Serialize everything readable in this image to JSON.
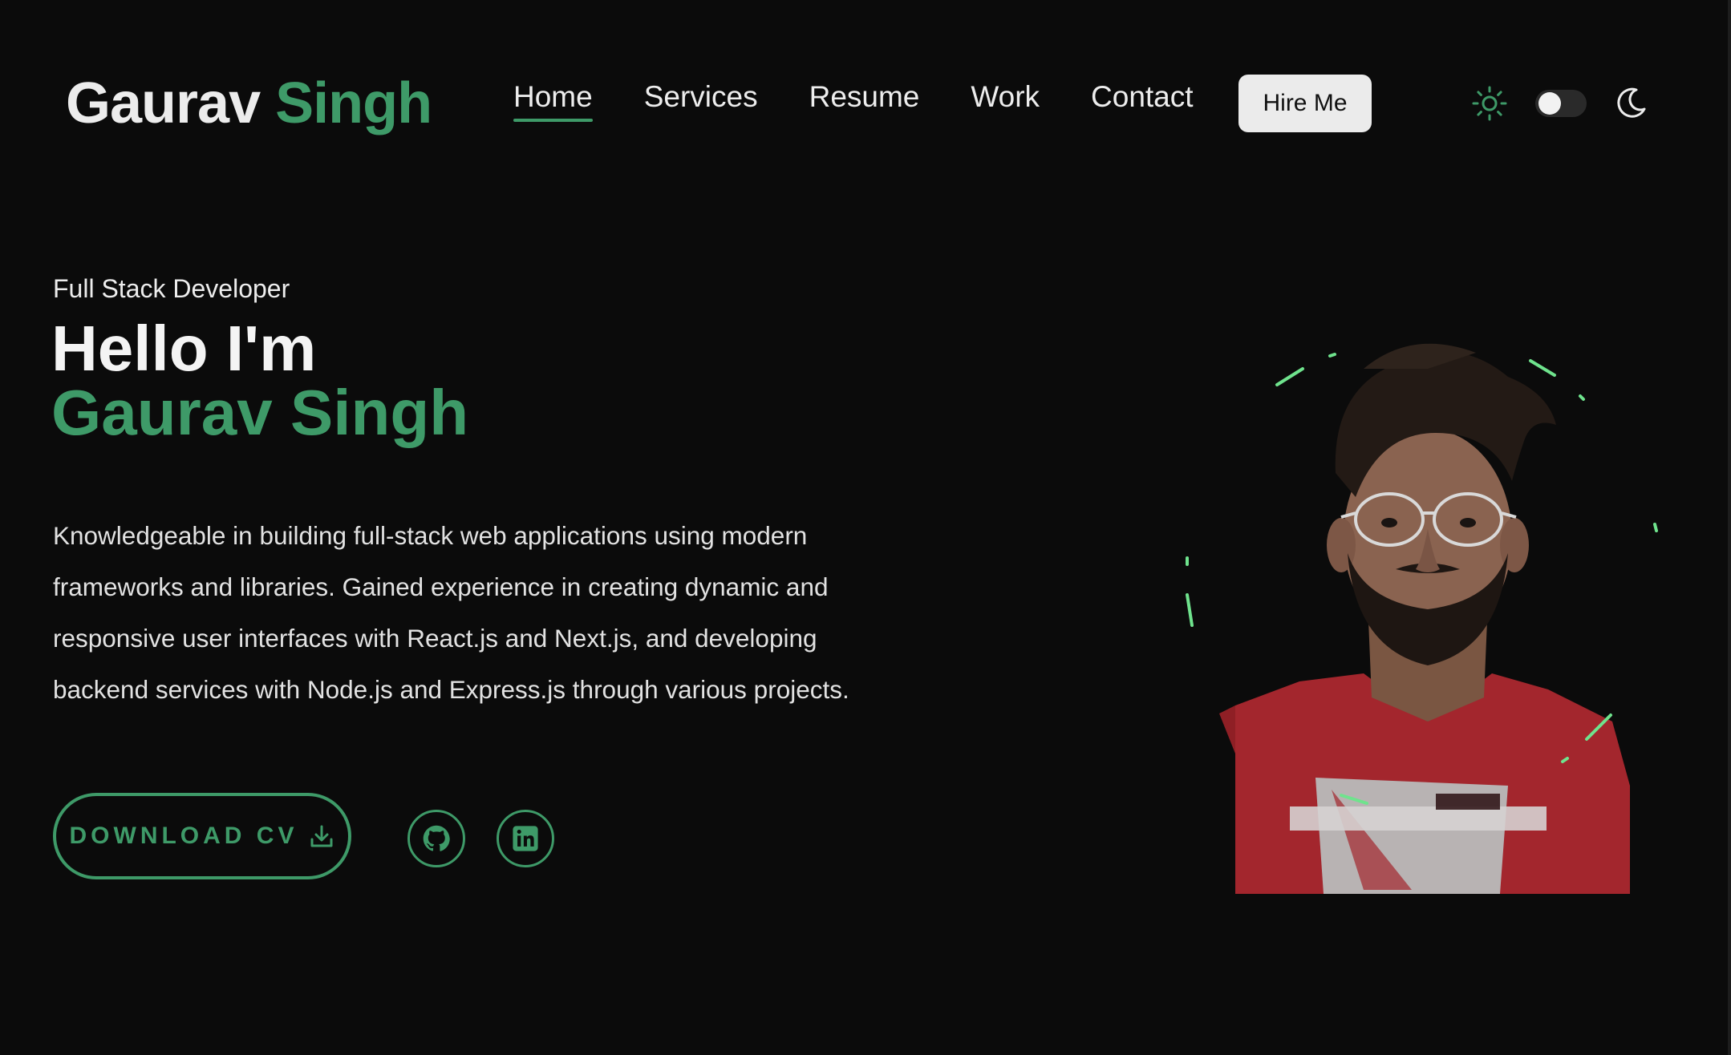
{
  "header": {
    "logo": {
      "first": "Gaurav",
      "last": "Singh"
    },
    "nav": [
      {
        "label": "Home",
        "active": true
      },
      {
        "label": "Services",
        "active": false
      },
      {
        "label": "Resume",
        "active": false
      },
      {
        "label": "Work",
        "active": false
      },
      {
        "label": "Contact",
        "active": false
      }
    ],
    "hire_label": "Hire Me",
    "theme": {
      "mode": "dark",
      "icons": [
        "sun-icon",
        "moon-icon"
      ]
    }
  },
  "hero": {
    "role": "Full Stack Developer",
    "greeting": "Hello I'm",
    "name": "Gaurav Singh",
    "description": "Knowledgeable in building full-stack web applications using modern frameworks and libraries. Gained experience in creating dynamic and responsive user interfaces with React.js and Next.js, and developing backend services with Node.js and Express.js through various projects.",
    "download_label": "DOWNLOAD CV",
    "socials": [
      {
        "icon": "github-icon"
      },
      {
        "icon": "linkedin-icon"
      }
    ]
  },
  "colors": {
    "accent": "#3e9a68",
    "spark": "#6fe38d",
    "background": "#0b0b0b",
    "text": "#ededed"
  }
}
